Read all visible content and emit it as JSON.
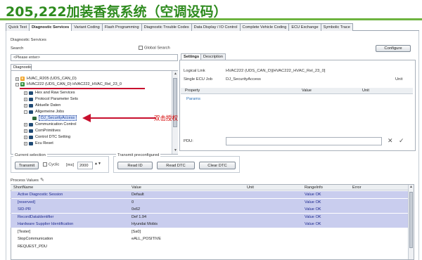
{
  "banner": {
    "title": "205,222加装香氛系统（空调设码）"
  },
  "tabs": [
    "Quick Test",
    "Diagnostic Services",
    "Variant Coding",
    "Flash Programming",
    "Diagnostic Trouble Codes",
    "Data Display / IO Control",
    "Complete Vehicle Coding",
    "ECU Exchange",
    "Symbolic Trace"
  ],
  "services": {
    "section_label": "Diagnostic Services",
    "search_label": "Search",
    "search_placeholder": "<Please enter>",
    "global_search_label": "Global Search",
    "configure_label": "Configure",
    "tree_tab": "Diagnostic",
    "tree": [
      {
        "label": "HVAC_R205 (UDS_CAN_D)",
        "icon": "ecu-icon",
        "level": 0
      },
      {
        "label": "HVAC222 (UDS_CAN_D) HVAC222_HVAC_Rel_23_0",
        "icon": "ecu-icon",
        "level": 0
      },
      {
        "label": "Hex and Raw Services",
        "icon": "folder-icon",
        "level": 1
      },
      {
        "label": "Protocol Parameter Sets",
        "icon": "folder-icon",
        "level": 1
      },
      {
        "label": "Aktuelle Daten",
        "icon": "folder-icon",
        "level": 1
      },
      {
        "label": "Allgemeine Jobs",
        "icon": "folder-icon",
        "level": 1
      },
      {
        "label": "DJ_SecurityAccess",
        "icon": "job-icon",
        "level": 2
      },
      {
        "label": "Communication Control",
        "icon": "folder-icon",
        "level": 1
      },
      {
        "label": "ComPrimitives",
        "icon": "folder-icon",
        "level": 1
      },
      {
        "label": "Control DTC Setting",
        "icon": "folder-icon",
        "level": 1
      },
      {
        "label": "Ecu Reset",
        "icon": "folder-icon",
        "level": 1
      }
    ]
  },
  "details": {
    "tabs": [
      "Settings",
      "Description"
    ],
    "logical_link_label": "Logical Link",
    "logical_link_value": "HVAC222 (UDS_CAN_D)[HVAC222_HVAC_Rel_23_0]",
    "single_ecu_job_label": "Single ECU Job",
    "single_ecu_job_value": "DJ_SecurityAccess",
    "unit_label": "Unit",
    "columns": [
      "Property",
      "Value",
      "Unit"
    ],
    "params_label": "Params",
    "pdu_label": "PDU:"
  },
  "annotation": "双击授权",
  "current_selection": {
    "label": "Current selection",
    "transmit": "Transmit",
    "cyclic": "Cyclic",
    "ms": "[ms]",
    "ms_value": "2000"
  },
  "transmit_preconfigured": {
    "label": "Transmit preconfigured",
    "buttons": [
      "Read ID",
      "Read DTC",
      "Clear DTC"
    ]
  },
  "process_values": {
    "label": "Process Values",
    "columns": [
      "ShortName",
      "Value",
      "Unit",
      "RangeInfo",
      "Error"
    ],
    "rows": [
      {
        "name": "Active Diagnostic Session",
        "value": "Default",
        "unit": "",
        "range": "Value OK",
        "error": "",
        "highlight": true
      },
      {
        "name": "[reserved]",
        "value": "0",
        "unit": "",
        "range": "Value OK",
        "error": "",
        "highlight": true
      },
      {
        "name": "SID-PR",
        "value": "0x62",
        "unit": "",
        "range": "Value OK",
        "error": "",
        "highlight": true
      },
      {
        "name": "RecordDataIdentifier",
        "value": "Def 1.94",
        "unit": "",
        "range": "Value OK",
        "error": "",
        "highlight": true
      },
      {
        "name": "Hardware Supplier Identification",
        "value": "Hyundai Mobis",
        "unit": "",
        "range": "Value OK",
        "error": "",
        "highlight": true
      },
      {
        "name": "[Tester]",
        "value": "[Sa0]",
        "unit": "",
        "range": "",
        "error": "",
        "highlight": false
      },
      {
        "name": "StopCommunication",
        "value": "eALL_POSITIVE",
        "unit": "",
        "range": "",
        "error": "",
        "highlight": false
      },
      {
        "name": "REQUEST_PDU",
        "value": "",
        "unit": "",
        "range": "",
        "error": "",
        "highlight": false
      }
    ]
  },
  "colors": {
    "banner_text": "#2e8b1e",
    "banner_line": "#6db33f",
    "annotation": "#d40000",
    "highlight_row": "#c9cdee"
  }
}
